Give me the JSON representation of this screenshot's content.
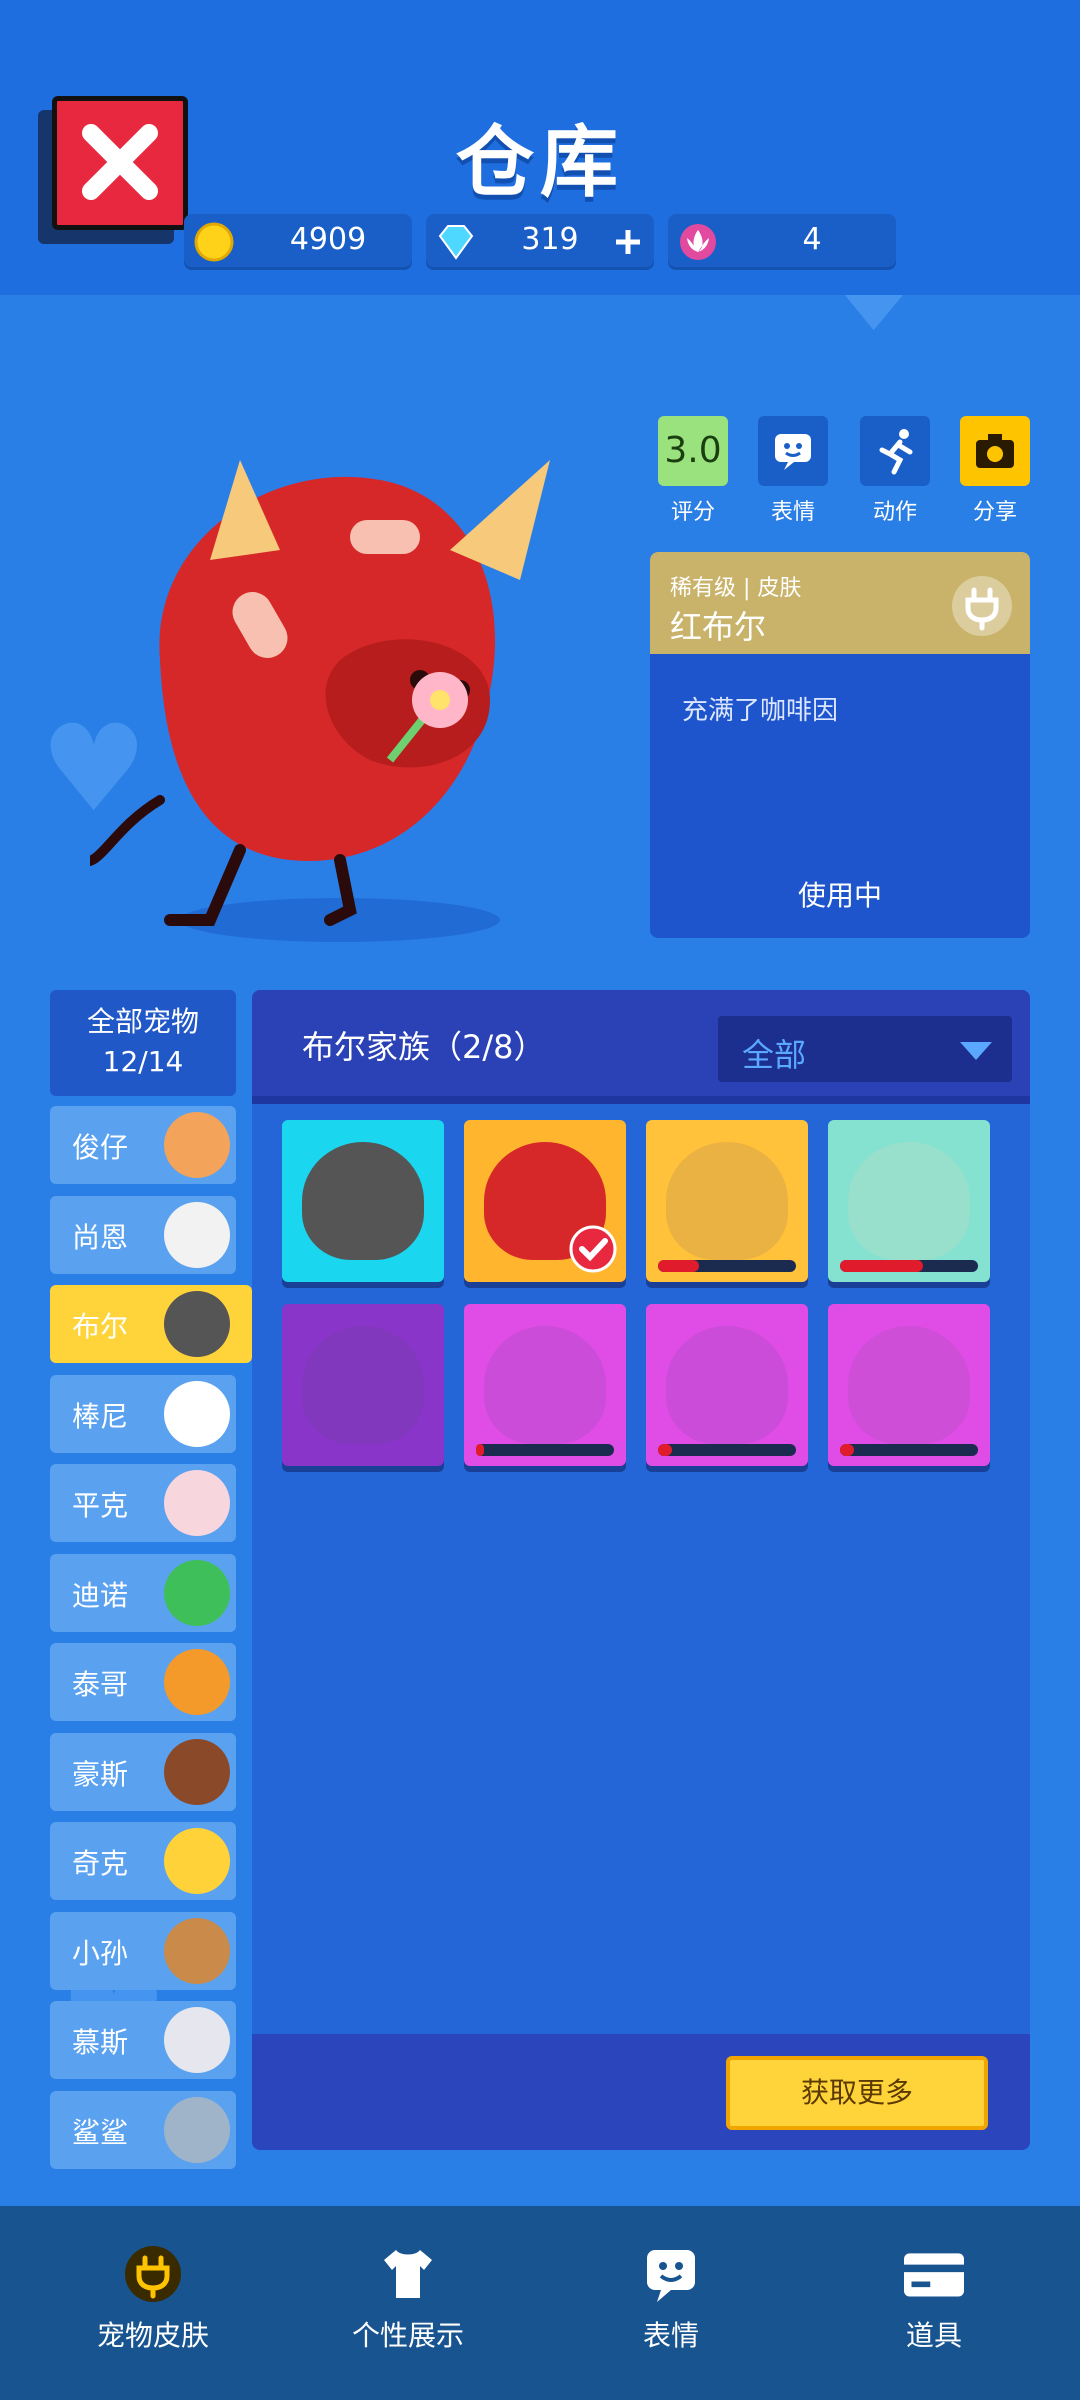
{
  "title": "仓库",
  "currencies": [
    {
      "icon": "gold-coin-icon",
      "value": "4909"
    },
    {
      "icon": "diamond-icon",
      "value": "319"
    },
    {
      "icon": "lotus-icon",
      "value": "4"
    }
  ],
  "actions": {
    "rating_value": "3.0",
    "rating_label": "评分",
    "emote_label": "表情",
    "motion_label": "动作",
    "share_label": "分享"
  },
  "skin_info": {
    "rarity": "稀有级 | 皮肤",
    "name": "红布尔",
    "description": "充满了咖啡因",
    "status": "使用中"
  },
  "sidebar": {
    "all_label": "全部宠物",
    "all_count": "12/14",
    "items": [
      {
        "label": "俊仔",
        "color": "#f3a35a"
      },
      {
        "label": "尚恩",
        "color": "#f2f2f2"
      },
      {
        "label": "布尔",
        "color": "#555555"
      },
      {
        "label": "棒尼",
        "color": "#ffffff"
      },
      {
        "label": "平克",
        "color": "#f7d6dd"
      },
      {
        "label": "迪诺",
        "color": "#3fbf5a"
      },
      {
        "label": "泰哥",
        "color": "#f39a2a"
      },
      {
        "label": "豪斯",
        "color": "#8a4a2a"
      },
      {
        "label": "奇克",
        "color": "#ffd23a"
      },
      {
        "label": "小孙",
        "color": "#c98a4a"
      },
      {
        "label": "慕斯",
        "color": "#e6e6ee"
      },
      {
        "label": "鲨鲨",
        "color": "#9fb4c8"
      }
    ]
  },
  "panel": {
    "family_title": "布尔家族（2/8）",
    "filter_label": "全部",
    "get_more": "获取更多"
  },
  "skins": [
    {
      "bg": "#1ad6ef",
      "body": "#555555",
      "progress": null,
      "owned": true
    },
    {
      "bg": "#ffb52e",
      "body": "#d62828",
      "progress": null,
      "owned": true,
      "selected": true
    },
    {
      "bg": "#ffc23a",
      "body": "#d9a54a",
      "progress": 0.3,
      "owned": false
    },
    {
      "bg": "#86e2d0",
      "body": "#a7dcc8",
      "progress": 0.6,
      "owned": false
    },
    {
      "bg": "#8a35c9",
      "body": "#7a3ab0",
      "progress": null,
      "owned": false
    },
    {
      "bg": "#e04ce6",
      "body": "#b84ccc",
      "progress": 0.0,
      "owned": false
    },
    {
      "bg": "#e04ce6",
      "body": "#b84ccc",
      "progress": 0.1,
      "owned": false
    },
    {
      "bg": "#e04ce6",
      "body": "#c050cc",
      "progress": 0.1,
      "owned": false
    }
  ],
  "nav": [
    {
      "label": "宠物皮肤",
      "icon": "plug-icon",
      "active": true
    },
    {
      "label": "个性展示",
      "icon": "tshirt-icon",
      "active": false
    },
    {
      "label": "表情",
      "icon": "emote-icon",
      "active": false
    },
    {
      "label": "道具",
      "icon": "card-icon",
      "active": false
    }
  ]
}
